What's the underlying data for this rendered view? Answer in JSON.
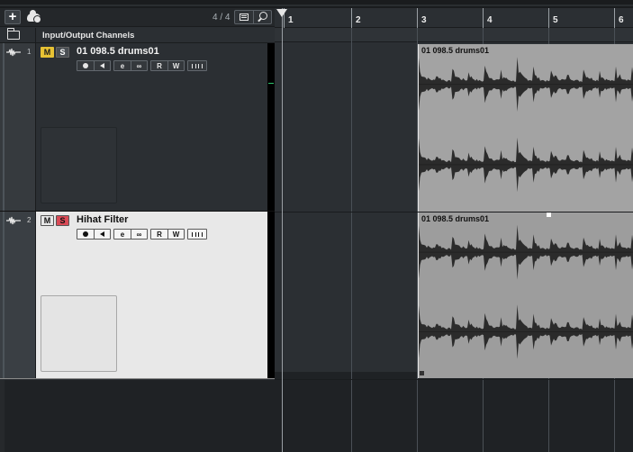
{
  "toolbar": {
    "add_symbol": "+",
    "track_count": "4 / 4",
    "icons": [
      "add-track-icon",
      "cloud-icon",
      "track-list-icon",
      "search-icon"
    ]
  },
  "folder_row": {
    "label": "Input/Output Channels",
    "icon": "folder-icon"
  },
  "tracks": [
    {
      "number": "1",
      "name": "01 098.5 drums01",
      "mute_label": "M",
      "solo_label": "S",
      "muted": true,
      "soloed": false,
      "selected": false,
      "read_label": "R",
      "write_label": "W",
      "edit_label": "e",
      "link_label": "∞",
      "event_name": "01 098.5 drums01"
    },
    {
      "number": "2",
      "name": "Hihat Filter",
      "mute_label": "M",
      "solo_label": "S",
      "muted": false,
      "soloed": true,
      "selected": true,
      "read_label": "R",
      "write_label": "W",
      "edit_label": "e",
      "link_label": "∞",
      "event_name": "01 098.5 drums01"
    }
  ],
  "ruler": {
    "bars": [
      "1",
      "2",
      "3",
      "4",
      "5",
      "6"
    ]
  },
  "colors": {
    "mute_active": "#e7c234",
    "solo_active": "#d94a56",
    "selected_track_bg": "#e8e8e8",
    "event_bg": "#a3a3a3",
    "meter_green": "#2fc46e"
  }
}
